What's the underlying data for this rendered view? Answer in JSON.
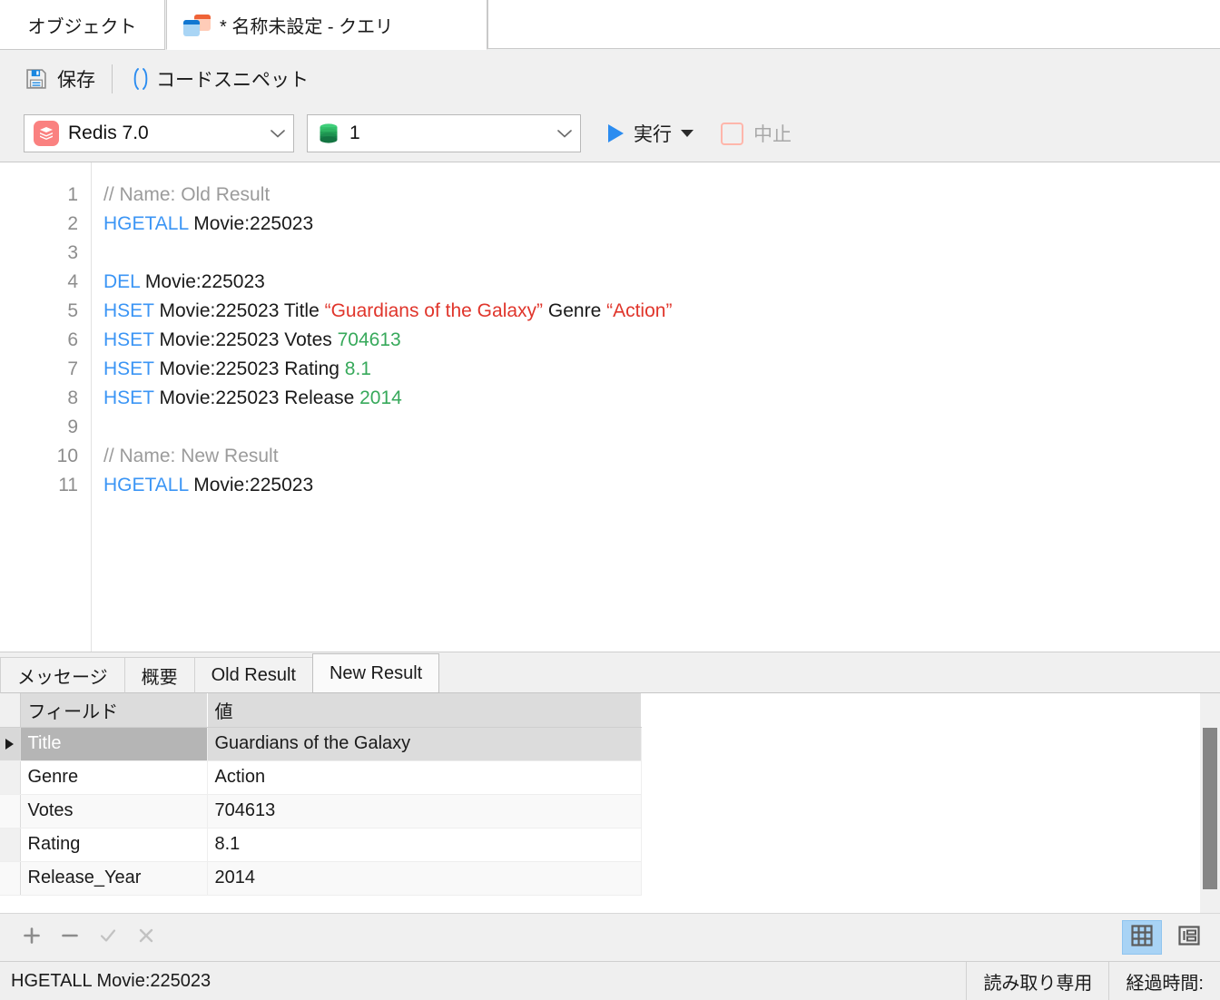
{
  "tabs": {
    "objects_label": "オブジェクト",
    "query_label": "* 名称未設定 - クエリ",
    "query_icon": "stacked-cards-icon"
  },
  "toolbar": {
    "save_label": "保存",
    "save_icon": "floppy-disk-icon",
    "snippet_label": "コードスニペット",
    "snippet_icon": "parentheses-icon",
    "connection_value": "Redis 7.0",
    "connection_icon": "redis-icon",
    "database_value": "1",
    "database_icon": "database-cylinder-icon",
    "run_label": "実行",
    "run_icon": "play-triangle-icon",
    "stop_label": "中止",
    "stop_icon": "stop-square-icon"
  },
  "editor": {
    "lines": [
      {
        "n": "1",
        "tokens": [
          {
            "t": "// Name: Old Result",
            "c": "cm"
          }
        ]
      },
      {
        "n": "2",
        "tokens": [
          {
            "t": "HGETALL",
            "c": "kw"
          },
          {
            "t": " Movie:225023",
            "c": ""
          }
        ]
      },
      {
        "n": "3",
        "tokens": []
      },
      {
        "n": "4",
        "tokens": [
          {
            "t": "DEL",
            "c": "kw"
          },
          {
            "t": " Movie:225023",
            "c": ""
          }
        ]
      },
      {
        "n": "5",
        "tokens": [
          {
            "t": "HSET",
            "c": "kw"
          },
          {
            "t": " Movie:225023 Title ",
            "c": ""
          },
          {
            "t": "“Guardians of the Galaxy”",
            "c": "str"
          },
          {
            "t": " Genre ",
            "c": ""
          },
          {
            "t": "“Action”",
            "c": "str"
          }
        ]
      },
      {
        "n": "6",
        "tokens": [
          {
            "t": "HSET",
            "c": "kw"
          },
          {
            "t": " Movie:225023 Votes ",
            "c": ""
          },
          {
            "t": "704613",
            "c": "num"
          }
        ]
      },
      {
        "n": "7",
        "tokens": [
          {
            "t": "HSET",
            "c": "kw"
          },
          {
            "t": " Movie:225023 Rating ",
            "c": ""
          },
          {
            "t": "8.1",
            "c": "num"
          }
        ]
      },
      {
        "n": "8",
        "tokens": [
          {
            "t": "HSET",
            "c": "kw"
          },
          {
            "t": " Movie:225023 Release ",
            "c": ""
          },
          {
            "t": "2014",
            "c": "num"
          }
        ]
      },
      {
        "n": "9",
        "tokens": []
      },
      {
        "n": "10",
        "tokens": [
          {
            "t": "// Name: New Result",
            "c": "cm"
          }
        ]
      },
      {
        "n": "11",
        "tokens": [
          {
            "t": "HGETALL",
            "c": "kw"
          },
          {
            "t": " Movie:225023",
            "c": ""
          }
        ]
      }
    ]
  },
  "results": {
    "tabs": [
      {
        "label": "メッセージ",
        "active": false
      },
      {
        "label": "概要",
        "active": false
      },
      {
        "label": "Old Result",
        "active": false
      },
      {
        "label": "New Result",
        "active": true
      }
    ],
    "columns": [
      "フィールド",
      "値"
    ],
    "rows": [
      {
        "field": "Title",
        "value": "Guardians of the Galaxy",
        "selected": true
      },
      {
        "field": "Genre",
        "value": "Action",
        "selected": false
      },
      {
        "field": "Votes",
        "value": "704613",
        "selected": false
      },
      {
        "field": "Rating",
        "value": "8.1",
        "selected": false
      },
      {
        "field": "Release_Year",
        "value": "2014",
        "selected": false
      }
    ]
  },
  "actionbar": {
    "add_icon": "plus-icon",
    "remove_icon": "minus-icon",
    "confirm_icon": "check-icon",
    "cancel_icon": "cross-icon",
    "grid_view_icon": "grid-view-icon",
    "form_view_icon": "form-view-icon"
  },
  "statusbar": {
    "query": "HGETALL Movie:225023",
    "readonly": "読み取り専用",
    "elapsed": "経過時間:"
  },
  "colors": {
    "keyword": "#3b95f5",
    "string": "#e0352b",
    "number": "#37a95b",
    "comment": "#9b9b9b",
    "accent": "#2b8cf0",
    "redis_brand": "#fa8180",
    "database_green": "#21a957"
  }
}
